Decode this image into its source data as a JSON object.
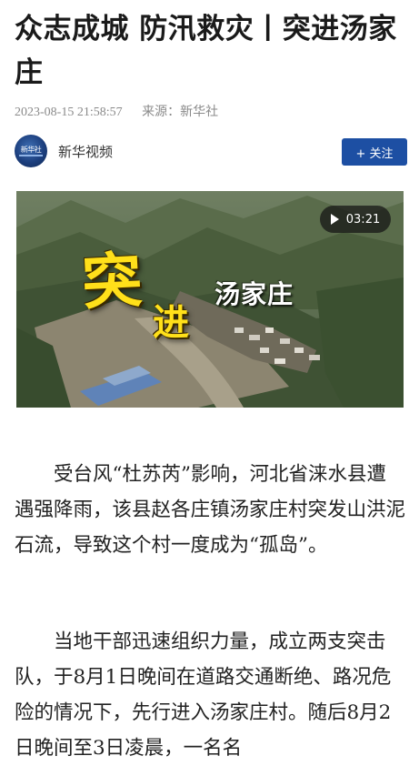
{
  "article": {
    "title": "众志成城 防汛救灾丨突进汤家庄",
    "date": "2023-08-15 21:58:57",
    "source": "来源：新华社"
  },
  "author": {
    "avatar_text": "新华社",
    "name": "新华视频",
    "follow_label": "+ 关注"
  },
  "video": {
    "duration": "03:21",
    "overlay_big": "突",
    "overlay_mid": "进",
    "overlay_place": "汤家庄",
    "play_icon": "play-icon"
  },
  "paragraphs": [
    "受台风“杜苏芮”影响，河北省涞水县遭遇强降雨，该县赵各庄镇汤家庄村突发山洪泥石流，导致这个村一度成为“孤岛”。",
    "当地干部迅速组织力量，成立两支突击队，于8月1日晚间在道路交通断绝、路况危险的情况下，先行进入汤家庄村。随后8月2日晚间至3日凌晨，一名名"
  ],
  "colors": {
    "follow_button": "#1d4fa3",
    "overlay_yellow": "#ffe01a"
  }
}
